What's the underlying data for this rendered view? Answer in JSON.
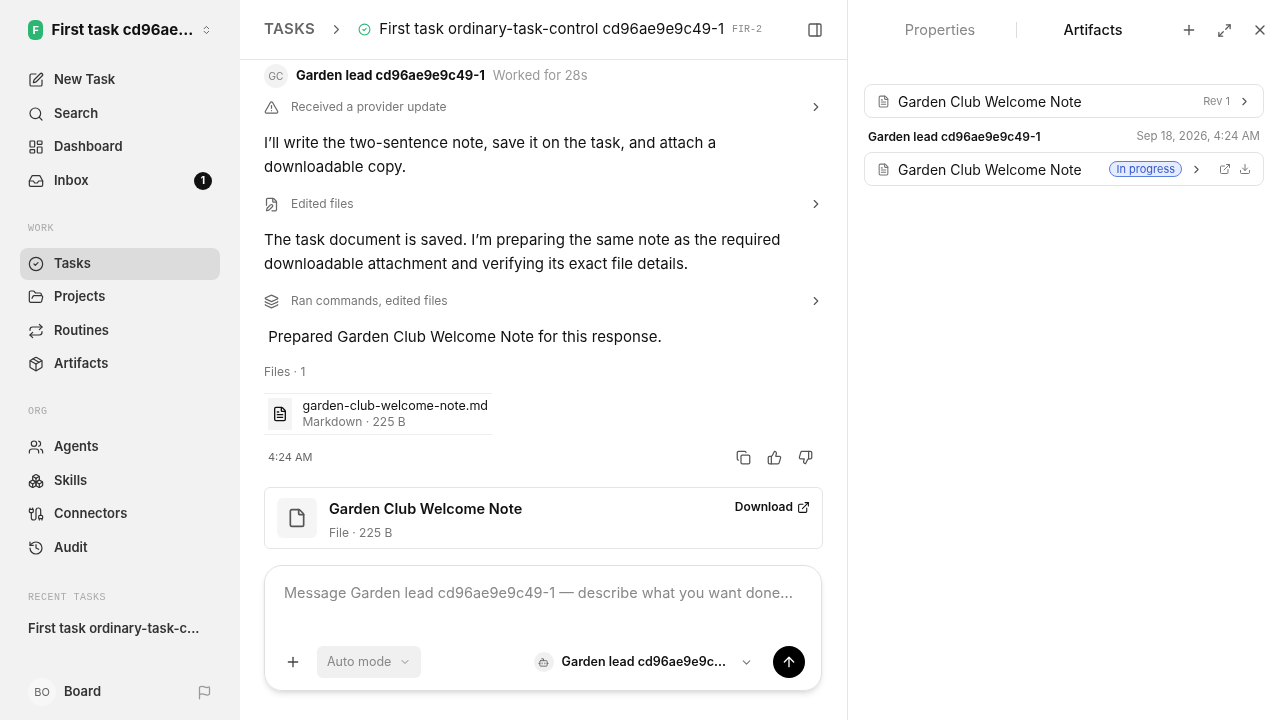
{
  "workspace": {
    "initial": "F",
    "name": "First task cd96ae..."
  },
  "nav": [
    {
      "label": "New Task",
      "selected": false
    },
    {
      "label": "Search",
      "selected": false
    },
    {
      "label": "Dashboard",
      "selected": false
    },
    {
      "label": "Inbox",
      "selected": false,
      "badge": "1"
    }
  ],
  "sections": [
    {
      "title": "WORK",
      "items": [
        {
          "label": "Tasks",
          "selected": true
        },
        {
          "label": "Projects",
          "selected": false
        },
        {
          "label": "Routines",
          "selected": false
        },
        {
          "label": "Artifacts",
          "selected": false
        }
      ]
    },
    {
      "title": "ORG",
      "items": [
        {
          "label": "Agents",
          "selected": false
        },
        {
          "label": "Skills",
          "selected": false
        },
        {
          "label": "Connectors",
          "selected": false
        },
        {
          "label": "Audit",
          "selected": false
        }
      ]
    }
  ],
  "recent": {
    "title": "RECENT TASKS",
    "items": [
      "First task ordinary-task-c..."
    ]
  },
  "user": {
    "initials": "BO",
    "name": "Board"
  },
  "header": {
    "crumb": "TASKS",
    "title": "First task ordinary-task-control cd96ae9e9c49-1",
    "code": "FIR-2"
  },
  "agent_line": {
    "initials": "GC",
    "name": "Garden lead cd96ae9e9c49-1",
    "worked": "Worked for 28s"
  },
  "thread": [
    {
      "kind": "step",
      "text": "Received a provider update"
    },
    {
      "kind": "message",
      "text": "I’ll write the two-sentence note, save it on the task, and attach a downloadable copy."
    },
    {
      "kind": "step",
      "text": "Edited files"
    },
    {
      "kind": "message",
      "text": "The task document is saved. I’m preparing the same note as the required downloadable attachment and verifying its exact file details."
    },
    {
      "kind": "step",
      "text": "Ran commands, edited files"
    },
    {
      "kind": "message",
      "text": " Prepared Garden Club Welcome Note for this response."
    }
  ],
  "files": {
    "label": "Files · 1",
    "items": [
      {
        "name": "garden-club-welcome-note.md",
        "meta": "Markdown · 225 B"
      }
    ]
  },
  "time": "4:24 AM",
  "attachment": {
    "title": "Garden Club Welcome Note",
    "meta": "File · 225 B",
    "action": "Download"
  },
  "composer": {
    "placeholder": "Message Garden lead cd96ae9e9c49-1 — describe what you want done...",
    "mode": "Auto mode",
    "agent": "Garden lead cd96ae9e9c..."
  },
  "panel": {
    "tabs": [
      {
        "label": "Properties",
        "selected": false
      },
      {
        "label": "Artifacts",
        "selected": true
      }
    ],
    "artifact": {
      "title": "Garden Club Welcome Note",
      "rev": "Rev 1"
    },
    "revision": {
      "author": "Garden lead cd96ae9e9c49-1",
      "date": "Sep 18, 2026, 4:24 AM",
      "title": "Garden Club Welcome Note",
      "status": "In progress"
    }
  }
}
